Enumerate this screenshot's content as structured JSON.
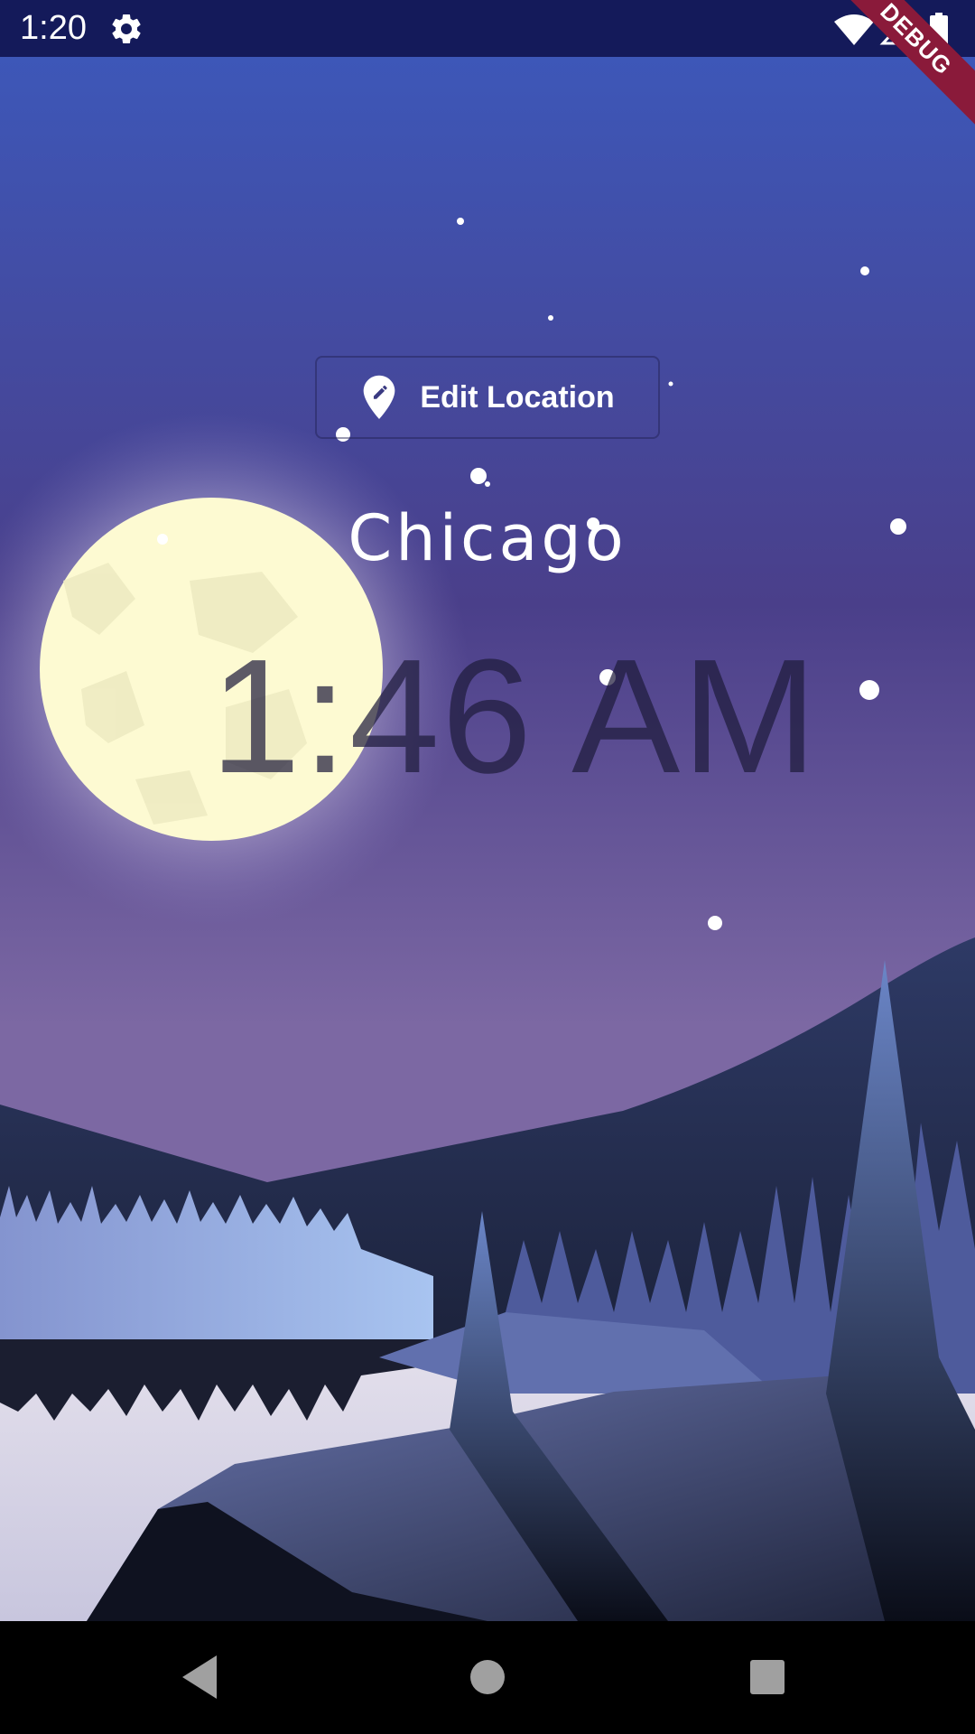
{
  "status_bar": {
    "time": "1:20",
    "settings_icon": "gear-icon",
    "wifi_icon": "wifi-icon",
    "signal_icon": "cell-signal-icon",
    "battery_icon": "battery-icon",
    "background_color": "#141a5a"
  },
  "debug_banner": {
    "label": "DEBUG",
    "color": "#8a1a3a"
  },
  "main": {
    "edit_location": {
      "label": "Edit Location",
      "icon": "edit-location-icon"
    },
    "location": "Chicago",
    "time": "1:46 AM"
  },
  "scene": {
    "sky_top_color": "#3d57b8",
    "sky_mid_color": "#4a3f8a",
    "sky_bottom_color": "#7c68a3",
    "moon_color": "#fdfad2"
  },
  "nav_bar": {
    "back_icon": "back-triangle-icon",
    "home_icon": "home-circle-icon",
    "recents_icon": "recents-square-icon"
  }
}
